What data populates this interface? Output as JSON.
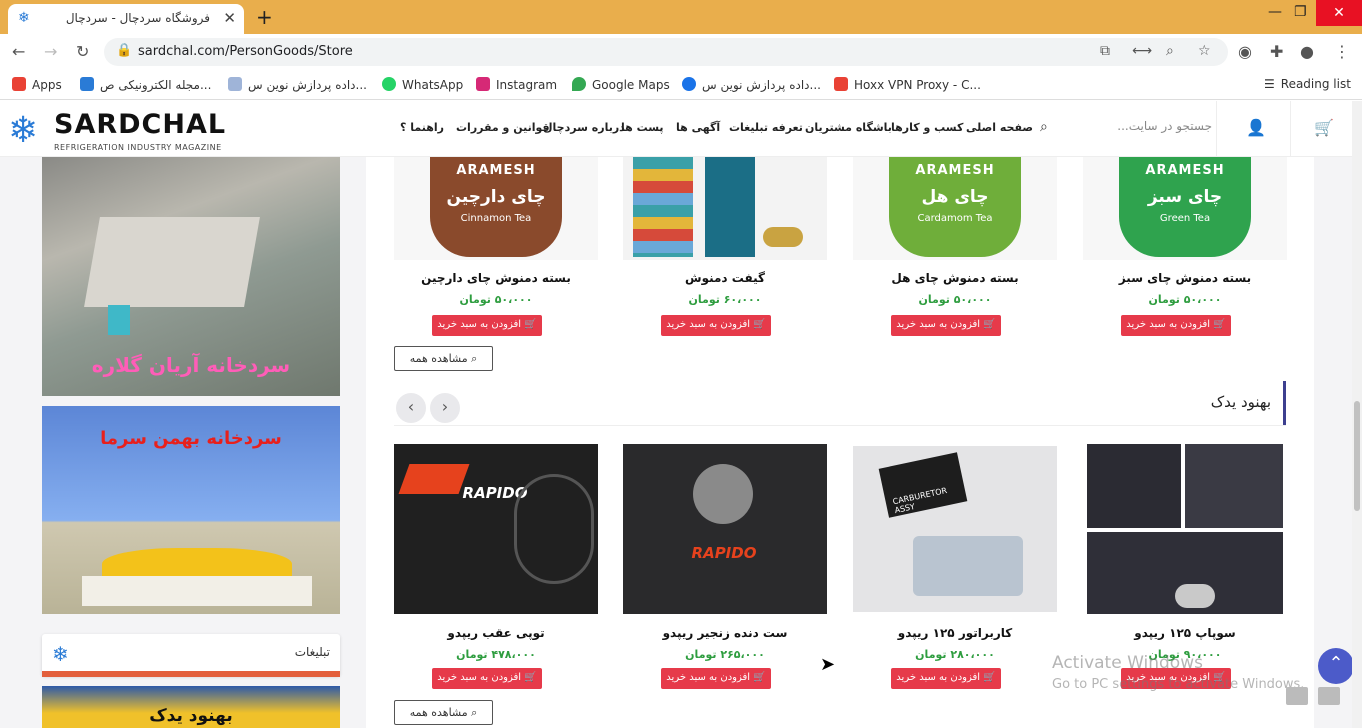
{
  "browser": {
    "tab_title": "فروشگاه سردچال - سردچال",
    "url": "sardchal.com/PersonGoods/Store",
    "bookmarks": [
      {
        "label": "Apps",
        "color": "#e94235"
      },
      {
        "label": "مجله الکترونیکی ص...",
        "color": "#2a7bd6"
      },
      {
        "label": "داده پردازش نوین س...",
        "color": "#9fb4d8"
      },
      {
        "label": "WhatsApp",
        "color": "#25d366"
      },
      {
        "label": "Instagram",
        "color": "#d62976"
      },
      {
        "label": "Google Maps",
        "color": "#34a853"
      },
      {
        "label": "داده پردازش نوین س...",
        "color": "#1a73e8"
      },
      {
        "label": "Hoxx VPN Proxy - C...",
        "color": "#e94235"
      }
    ],
    "reading_list": "Reading list"
  },
  "site": {
    "logo_main": "SARDCHAL",
    "logo_sub": "REFRIGERATION INDUSTRY MAGAZINE",
    "menu": [
      "صفحه اصلی",
      "کسب و کارها",
      "باشگاه مشتریان",
      "تعرفه تبلیغات",
      "آگهی ها",
      "پست ها",
      "درباره سردچال",
      "قوانین و مقررات",
      "راهنما ؟"
    ],
    "search_placeholder": "جستجو در سایت..."
  },
  "sidebar": {
    "banner1_text": "سردخانه آریان گلاره",
    "banner2_text": "سردخانه بهمن سرما",
    "ads_label": "تبلیغات",
    "banner3_text": "بهنود یدک"
  },
  "section1": {
    "products": [
      {
        "name": "بسته دمنوش چای دارچین",
        "price": "۵۰،۰۰۰ تومان",
        "brand": "ARAMESH",
        "fa": "چای دارچین",
        "en": "Cinnamon Tea",
        "color": "#8a4a2c"
      },
      {
        "name": "گیفت دمنوش",
        "price": "۶۰،۰۰۰ تومان",
        "brand": "",
        "fa": "",
        "en": "",
        "color": "#1b6e86"
      },
      {
        "name": "بسته دمنوش چای هل",
        "price": "۵۰،۰۰۰ تومان",
        "brand": "ARAMESH",
        "fa": "چای هل",
        "en": "Cardamom Tea",
        "color": "#6fae3a"
      },
      {
        "name": "بسته دمنوش چای سبز",
        "price": "۵۰،۰۰۰ تومان",
        "brand": "ARAMESH",
        "fa": "چای سبز",
        "en": "Green Tea",
        "color": "#2fa34e"
      }
    ],
    "add_label": "افزودن به سبد خرید",
    "see_all": "مشاهده همه"
  },
  "section2": {
    "title": "بهنود یدک",
    "products": [
      {
        "name": "توپی عقب ریپدو",
        "price": "۴۷۸،۰۰۰ تومان",
        "img_text": "RAPIDO"
      },
      {
        "name": "ست دنده زنجیر ریپدو",
        "price": "۲۶۵،۰۰۰ تومان",
        "img_text": "RAPIDO"
      },
      {
        "name": "کاربراتور ۱۲۵ ریپدو",
        "price": "۲۸۰،۰۰۰ تومان",
        "img_text": "CARBURETOR ASSY"
      },
      {
        "name": "سوپاپ ۱۲۵ ریپدو",
        "price": "۹۰،۰۰۰ تومان",
        "img_text": ""
      }
    ],
    "add_label": "افزودن به سبد خرید",
    "see_all": "مشاهده همه"
  },
  "overlay": {
    "activate_title": "Activate Windows",
    "activate_sub": "Go to PC settings to activate Windows."
  }
}
